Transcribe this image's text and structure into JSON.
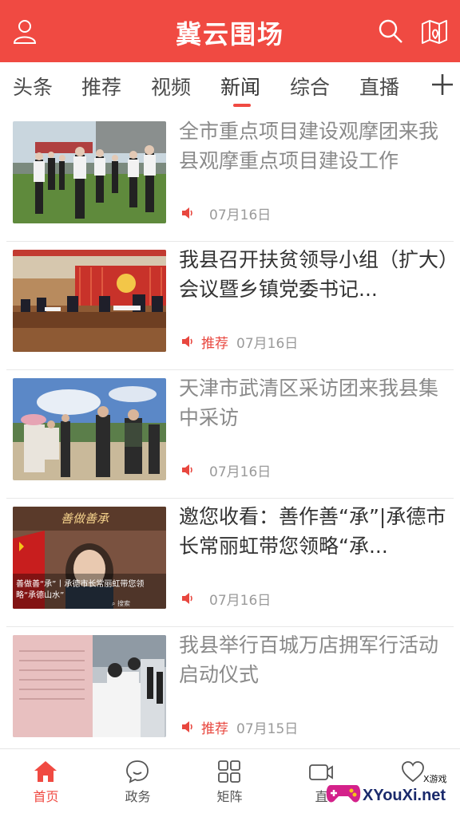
{
  "header": {
    "title": "冀云围场"
  },
  "tabs": [
    {
      "label": "头条"
    },
    {
      "label": "推荐"
    },
    {
      "label": "视频"
    },
    {
      "label": "新闻",
      "active": true
    },
    {
      "label": "综合"
    },
    {
      "label": "直播"
    }
  ],
  "news": [
    {
      "title": "全市重点项目建设观摩团来我县观摩重点项目建设工作",
      "tag": "",
      "date": "07月16日",
      "read": true
    },
    {
      "title": "我县召开扶贫领导小组（扩大）会议暨乡镇党委书记...",
      "tag": "推荐",
      "date": "07月16日",
      "read": false
    },
    {
      "title": "天津市武清区采访团来我县集中采访",
      "tag": "",
      "date": "07月16日",
      "read": true
    },
    {
      "title": "邀您收看：善作善“承”|承德市长常丽虹带您领略“承...",
      "tag": "",
      "date": "07月16日",
      "read": false
    },
    {
      "title": "我县举行百城万店拥军行活动启动仪式",
      "tag": "推荐",
      "date": "07月15日",
      "read": true
    }
  ],
  "thumb4": {
    "banner": "善做善承",
    "caption_line1": "善做善“承”丨承德市长常丽虹带您领",
    "caption_line2": "略“承德山水”",
    "search_label": "搜索"
  },
  "bottom_nav": [
    {
      "label": "首页",
      "active": true
    },
    {
      "label": "政务"
    },
    {
      "label": "矩阵"
    },
    {
      "label": "直"
    },
    {
      "label": ""
    }
  ],
  "watermark": {
    "text": "XYouXi.net",
    "small": "X游戏"
  },
  "colors": {
    "brand": "#f04a42",
    "text": "#333333",
    "read_text": "#8a8a8a",
    "meta": "#9a9a9a"
  }
}
